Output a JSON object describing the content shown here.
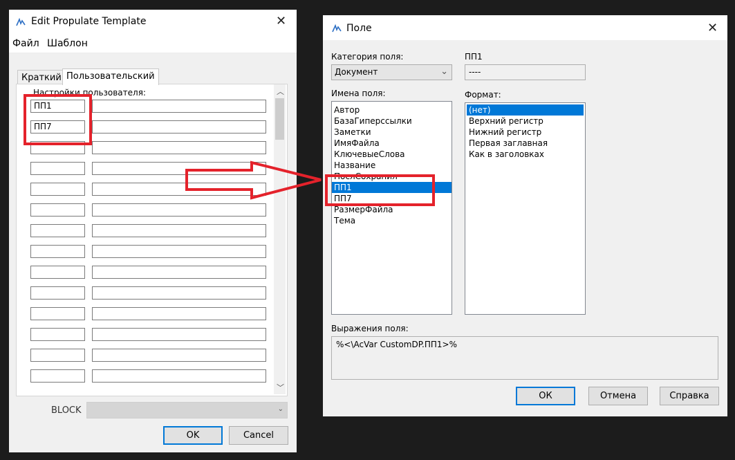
{
  "left_window": {
    "title": "Edit Propulate Template",
    "menu": [
      "Файл",
      "Шаблон"
    ],
    "tabs": [
      "Краткий",
      "Пользовательский"
    ],
    "section_label": "Настройки пользователя:",
    "rows": [
      {
        "name": "ПП1",
        "value": ""
      },
      {
        "name": "ПП7",
        "value": ""
      },
      {
        "name": "",
        "value": ""
      },
      {
        "name": "",
        "value": ""
      },
      {
        "name": "",
        "value": ""
      },
      {
        "name": "",
        "value": ""
      },
      {
        "name": "",
        "value": ""
      },
      {
        "name": "",
        "value": ""
      },
      {
        "name": "",
        "value": ""
      },
      {
        "name": "",
        "value": ""
      },
      {
        "name": "",
        "value": ""
      },
      {
        "name": "",
        "value": ""
      },
      {
        "name": "",
        "value": ""
      },
      {
        "name": "",
        "value": ""
      }
    ],
    "block_label": "BLOCK",
    "block_value": "",
    "ok_label": "OK",
    "cancel_label": "Cancel"
  },
  "right_window": {
    "title": "Поле",
    "category_label": "Категория поля:",
    "category_value": "Документ",
    "field_names_label": "Имена поля:",
    "field_names": [
      "Автор",
      "БазаГиперссылки",
      "Заметки",
      "ИмяФайла",
      "КлючевыеСлова",
      "Название",
      "ПослСохранил",
      "ПП1",
      "ПП7",
      "РазмерФайла",
      "Тема"
    ],
    "selected_field_index": 7,
    "value_label": "ПП1",
    "value_text": "----",
    "format_label": "Формат:",
    "formats": [
      "(нет)",
      "Верхний регистр",
      "Нижний регистр",
      "Первая заглавная",
      "Как в заголовках"
    ],
    "selected_format_index": 0,
    "expression_label": "Выражения поля:",
    "expression_value": "%<\\AcVar CustomDP.ПП1>%",
    "ok_label": "ОК",
    "cancel_label": "Отмена",
    "help_label": "Справка"
  },
  "colors": {
    "highlight_red": "#e4222b",
    "selection_blue": "#0078d7",
    "background": "#1c1c1c"
  }
}
